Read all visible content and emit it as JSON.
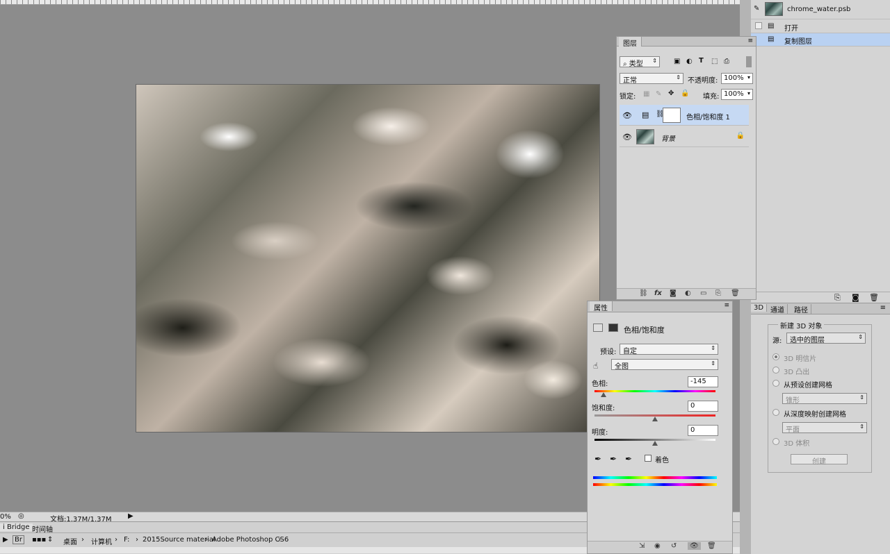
{
  "document": {
    "zoom": "0%",
    "doc_size": "文档:1.37M/1.37M"
  },
  "history": {
    "snapshot_name": "chrome_water.psb",
    "items": [
      {
        "label": "打开"
      },
      {
        "label": "复制图层"
      }
    ]
  },
  "layers": {
    "tab": "图层",
    "filter": "类型",
    "blend_mode": "正常",
    "opacity_label": "不透明度:",
    "opacity_value": "100%",
    "lock_label": "锁定:",
    "fill_label": "填充:",
    "fill_value": "100%",
    "items": [
      {
        "name": "色相/饱和度 1",
        "selected": true
      },
      {
        "name": "背景",
        "locked": true
      }
    ]
  },
  "properties": {
    "tab": "属性",
    "title": "色相/饱和度",
    "preset_label": "预设:",
    "preset_value": "自定",
    "channel_value": "全图",
    "hue_label": "色相:",
    "hue_value": "-145",
    "saturation_label": "饱和度:",
    "saturation_value": "0",
    "lightness_label": "明度:",
    "lightness_value": "0",
    "colorize_label": "着色"
  },
  "threed": {
    "tabs": [
      "3D",
      "通道",
      "路径"
    ],
    "group_title": "新建 3D 对象",
    "source_label": "源:",
    "source_value": "选中的图层",
    "options": [
      {
        "label": "3D 明信片",
        "checked": true
      },
      {
        "label": "3D 凸出",
        "checked": false
      },
      {
        "label": "从预设创建网格",
        "checked": false
      },
      {
        "label": "从深度映射创建网格",
        "checked": false
      },
      {
        "label": "3D 体积",
        "checked": false
      }
    ],
    "preset_mesh": "锥形",
    "depth_mesh": "平面",
    "create_label": "创建"
  },
  "bottom": {
    "tab_bridge": "i Bridge",
    "tab_timeline": "时间轴",
    "path": [
      "桌面",
      "计算机",
      "F:",
      "2015Source material",
      "Adobe Photoshop CS6"
    ]
  },
  "colors": {
    "selected_row": "#c6d9f3",
    "history_selected": "#b9d1f2",
    "panel_bg": "#d6d6d6",
    "workspace": "#8c8c8c"
  }
}
